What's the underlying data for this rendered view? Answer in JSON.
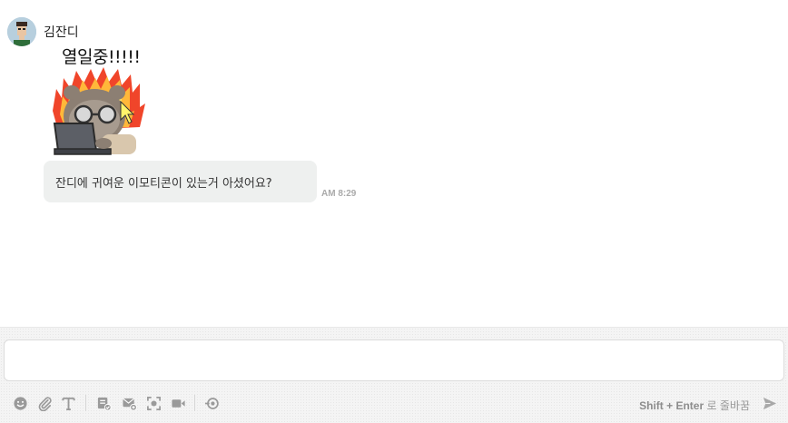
{
  "message": {
    "sender": "김잔디",
    "emoticon_caption": "열일중!!!!!",
    "text": "잔디에 귀여운 이모티콘이 있는거 아셨어요?",
    "time": "AM 8:29"
  },
  "composer": {
    "input_value": "",
    "input_placeholder": "",
    "hint_key": "Shift + Enter",
    "hint_text": " 로 줄바꿈",
    "icons": [
      "emoji-icon",
      "attach-icon",
      "text-format-icon",
      "todo-icon",
      "email-icon",
      "screen-capture-icon",
      "video-icon",
      "integration-icon",
      "send-icon"
    ]
  },
  "colors": {
    "bubble": "#eef0ef",
    "icon": "#9a9a9a",
    "fire_outer": "#f0452a",
    "fire_inner": "#ffd23a"
  }
}
